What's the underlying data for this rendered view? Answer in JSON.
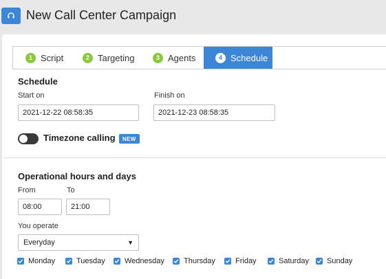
{
  "header": {
    "title": "New Call Center Campaign",
    "logo_icon": "headset-icon"
  },
  "tabs": [
    {
      "num": "1",
      "label": "Script"
    },
    {
      "num": "2",
      "label": "Targeting"
    },
    {
      "num": "3",
      "label": "Agents"
    },
    {
      "num": "4",
      "label": "Schedule"
    }
  ],
  "active_tab": "Schedule",
  "schedule": {
    "title": "Schedule",
    "start_label": "Start on",
    "start_value": "2021-12-22 08:58:35",
    "finish_label": "Finish on",
    "finish_value": "2021-12-23 08:58:35",
    "timezone_label": "Timezone calling",
    "timezone_on": false,
    "new_badge": "NEW"
  },
  "operational": {
    "title": "Operational hours and days",
    "from_label": "From",
    "from_value": "08:00",
    "to_label": "To",
    "to_value": "21:00",
    "operate_label": "You operate",
    "operate_value": "Everyday",
    "days": [
      "Monday",
      "Tuesday",
      "Wednesday",
      "Thursday",
      "Friday",
      "Saturday",
      "Sunday"
    ]
  },
  "colors": {
    "accent": "#3b86d6",
    "step_green": "#8dc63f",
    "toggle_off": "#3a3a3a"
  }
}
